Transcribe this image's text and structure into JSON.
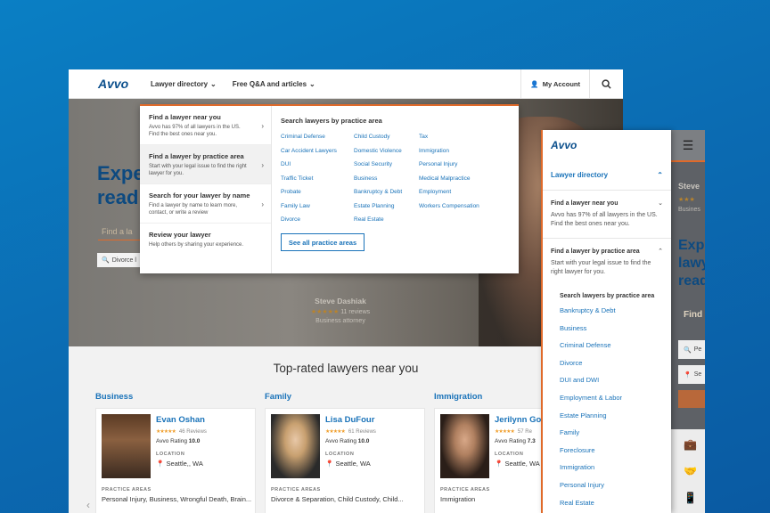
{
  "desktop": {
    "logo": "Avvo",
    "nav": {
      "directory": "Lawyer directory",
      "qa": "Free Q&A and articles",
      "account": "My Account"
    },
    "hero": {
      "headline_1": "Expe",
      "headline_2": "read",
      "find": "Find a la",
      "divorce": "Divorce l"
    },
    "featured": {
      "name": "Steve Dashiak",
      "reviews": "11 reviews",
      "title": "Business attorney"
    },
    "dropdown": {
      "left": [
        {
          "title": "Find a lawyer near you",
          "desc": "Avvo has 97% of all lawyers in the US. Find the best ones near you."
        },
        {
          "title": "Find a lawyer by practice area",
          "desc": "Start with your legal issue to find the right lawyer for you."
        },
        {
          "title": "Search for your lawyer by name",
          "desc": "Find a lawyer by name to learn more, contact, or write a review"
        },
        {
          "title": "Review your lawyer",
          "desc": "Help others by sharing your experience."
        }
      ],
      "right_title": "Search lawyers by practice area",
      "col1": [
        "Criminal Defense",
        "Car Accident Lawyers",
        "DUI",
        "Traffic Ticket",
        "Probate",
        "Family Law",
        "Divorce"
      ],
      "col2": [
        "Child Custody",
        "Domestic Violence",
        "Social Security",
        "Business",
        "Bankruptcy & Debt",
        "Estate Planning",
        "Real Estate"
      ],
      "col3": [
        "Tax",
        "Immigration",
        "Personal Injury",
        "Medical Malpractice",
        "Employment",
        "Workers Compensation"
      ],
      "see_all": "See all practice areas"
    },
    "top_rated_title": "Top-rated lawyers near you",
    "columns": [
      {
        "category": "Business",
        "name": "Evan Oshan",
        "reviews": "46 Reviews",
        "rating_label": "Avvo Rating",
        "rating": "10.0",
        "location_label": "LOCATION",
        "location": "Seattle,, WA",
        "pa_label": "PRACTICE AREAS",
        "areas": "Personal Injury, Business, Wrongful Death, Brain..."
      },
      {
        "category": "Family",
        "name": "Lisa DuFour",
        "reviews": "61 Reviews",
        "rating_label": "Avvo Rating",
        "rating": "10.0",
        "location_label": "LOCATION",
        "location": "Seattle, WA",
        "pa_label": "PRACTICE AREAS",
        "areas": "Divorce & Separation, Child Custody, Child..."
      },
      {
        "category": "Immigration",
        "name": "Jerilynn Gor",
        "reviews": "57 Re",
        "rating_label": "Avvo Rating",
        "rating": "7.3",
        "location_label": "LOCATION",
        "location": "Seattle, WA",
        "pa_label": "PRACTICE AREAS",
        "areas": "Immigration"
      }
    ]
  },
  "mobile": {
    "logo": "Avvo",
    "directory": "Lawyer directory",
    "near": {
      "title": "Find a lawyer near you",
      "desc": "Avvo has 97% of all lawyers in the US. Find the best ones near you."
    },
    "practice": {
      "title": "Find a lawyer by practice area",
      "desc": "Start with your legal issue to find the right lawyer for you."
    },
    "sub_title": "Search lawyers by practice area",
    "areas": [
      "Bankruptcy & Debt",
      "Business",
      "Criminal Defense",
      "Divorce",
      "DUI and DWI",
      "Employment & Labor",
      "Estate Planning",
      "Family",
      "Foreclosure",
      "Immigration",
      "Personal Injury",
      "Real Estate"
    ]
  },
  "mobile_bg": {
    "steve": "Steve",
    "business": "Busines",
    "headline": "Expe\nlawy\nread",
    "find": "Find",
    "inp1": "Pe",
    "inp2": "Se"
  }
}
